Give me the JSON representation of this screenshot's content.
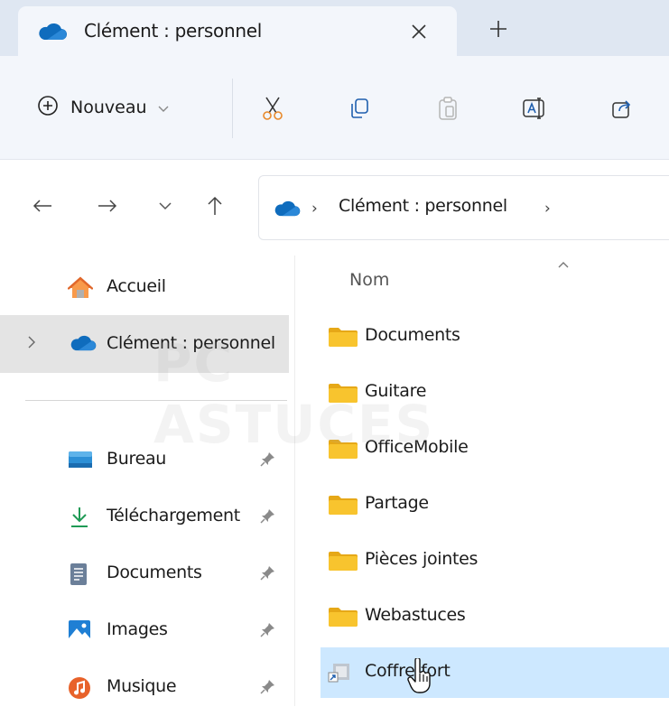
{
  "tab": {
    "title": "Clément : personnel"
  },
  "toolbar": {
    "new_label": "Nouveau"
  },
  "address": {
    "crumb": "Clément : personnel"
  },
  "sidebar": {
    "items": [
      {
        "label": "Accueil"
      },
      {
        "label": "Clément : personnel"
      },
      {
        "label": "Bureau"
      },
      {
        "label": "Téléchargement"
      },
      {
        "label": "Documents"
      },
      {
        "label": "Images"
      },
      {
        "label": "Musique"
      }
    ]
  },
  "filelist": {
    "column_header": "Nom",
    "files": [
      {
        "name": "Documents"
      },
      {
        "name": "Guitare"
      },
      {
        "name": "OfficeMobile"
      },
      {
        "name": "Partage"
      },
      {
        "name": "Pièces jointes"
      },
      {
        "name": "Webastuces"
      },
      {
        "name": "Coffre-fort"
      }
    ]
  },
  "watermark": {
    "text": "PC ASTUCES"
  },
  "colors": {
    "tabbar_bg": "#dfe7f2",
    "toolbar_bg": "#f3f6fb",
    "onedrive_blue": "#0f6cbd",
    "folder_yellow": "#f8c42e",
    "selected_row": "#cde8ff",
    "sidebar_selected": "#e4e4e4"
  },
  "icons": [
    "onedrive-cloud-icon",
    "close-icon",
    "plus-icon",
    "add-circle-icon",
    "cut-icon",
    "copy-icon",
    "paste-icon",
    "rename-icon",
    "share-icon",
    "back-arrow-icon",
    "forward-arrow-icon",
    "history-chevron-icon",
    "up-arrow-icon",
    "home-icon",
    "desktop-icon",
    "download-icon",
    "document-icon",
    "image-icon",
    "music-icon",
    "pin-icon",
    "folder-icon",
    "shortcut-icon",
    "mouse-cursor-icon"
  ]
}
